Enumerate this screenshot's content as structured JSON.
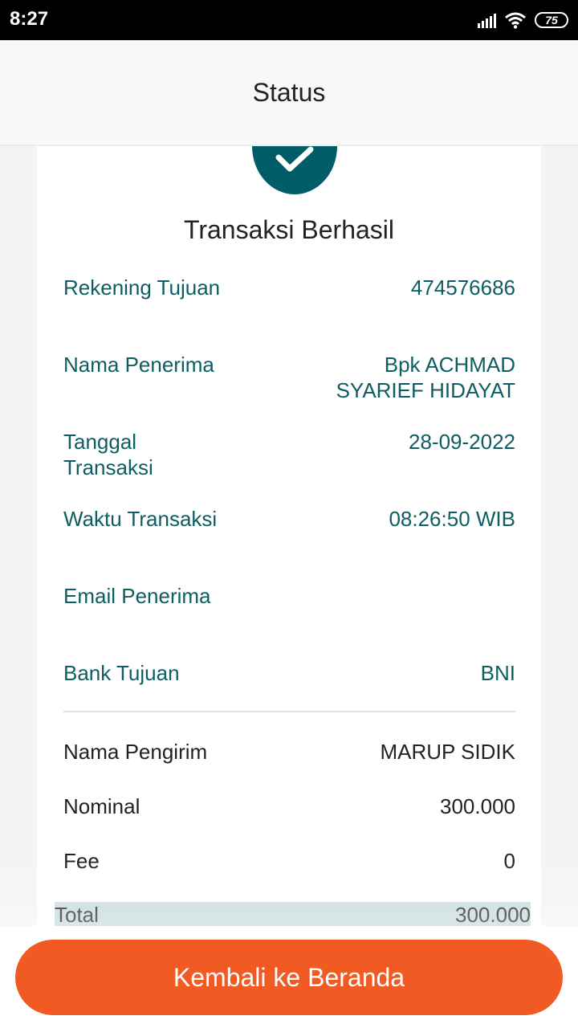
{
  "status_bar": {
    "time": "8:27",
    "battery": "75"
  },
  "app_bar": {
    "title": "Status"
  },
  "receipt": {
    "heading": "Transaksi Berhasil",
    "rekening_tujuan": {
      "label": "Rekening Tujuan",
      "value": "474576686"
    },
    "nama_penerima": {
      "label": "Nama Penerima",
      "value": "Bpk ACHMAD SYARIEF HIDAYAT"
    },
    "tanggal_transaksi": {
      "label": "Tanggal Transaksi",
      "value": "28-09-2022"
    },
    "waktu_transaksi": {
      "label": "Waktu Transaksi",
      "value": "08:26:50 WIB"
    },
    "email_penerima": {
      "label": "Email Penerima",
      "value": ""
    },
    "bank_tujuan": {
      "label": "Bank Tujuan",
      "value": "BNI"
    },
    "nama_pengirim": {
      "label": "Nama Pengirim",
      "value": "MARUP SIDIK"
    },
    "nominal": {
      "label": "Nominal",
      "value": "300.000"
    },
    "fee": {
      "label": "Fee",
      "value": "0"
    },
    "total": {
      "label": "Total",
      "value": "300.000"
    }
  },
  "footer": {
    "button_label": "Kembali ke Beranda"
  },
  "colors": {
    "primary": "#005c66",
    "accent": "#f15a22",
    "total_bg": "#c6d9dd"
  },
  "icons": {
    "success": "check-icon",
    "signal": "signal-icon",
    "wifi": "wifi-icon",
    "battery": "battery-icon"
  }
}
